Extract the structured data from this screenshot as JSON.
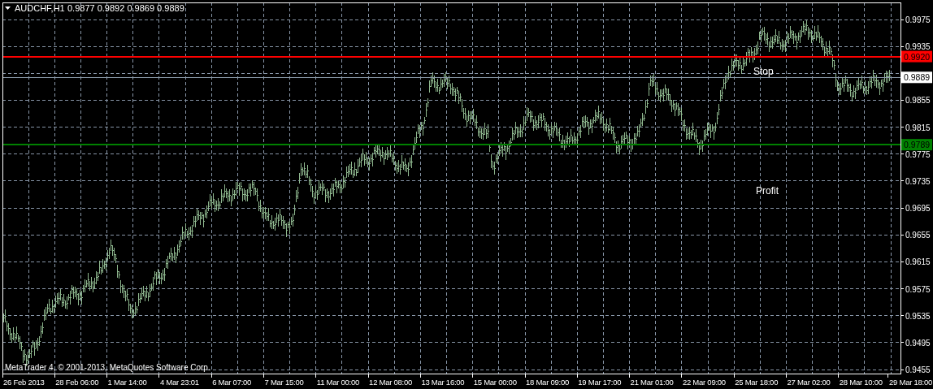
{
  "header": {
    "symbol": "AUDCHF,H1",
    "ohlc": "0.9877 0.9892 0.9869 0.9889"
  },
  "chart": {
    "price_axis": [
      "0.9975",
      "0.9935",
      "0.9855",
      "0.9815",
      "0.9775",
      "0.9735",
      "0.9695",
      "0.9655",
      "0.9615",
      "0.9575",
      "0.9535",
      "0.9495",
      "0.9455"
    ],
    "time_axis": [
      "26 Feb 2013",
      "28 Feb 06:00",
      "1 Mar 14:00",
      "4 Mar 23:01",
      "6 Mar 07:00",
      "7 Mar 15:00",
      "11 Mar 00:00",
      "12 Mar 08:00",
      "13 Mar 16:00",
      "15 Mar 00:00",
      "18 Mar 09:00",
      "19 Mar 17:00",
      "21 Mar 01:00",
      "22 Mar 09:00",
      "25 Mar 18:00",
      "27 Mar 02:00",
      "28 Mar 10:00",
      "29 Mar 18:00"
    ],
    "lines": [
      {
        "kind": "stop",
        "price": "0.9920",
        "color": "#ff0000"
      },
      {
        "kind": "bid",
        "price": "0.9889",
        "color": "#ffffff"
      },
      {
        "kind": "profit",
        "price": "0.9789",
        "color": "#008000"
      }
    ],
    "annotations": [
      {
        "text": "Stop"
      },
      {
        "text": "Profit"
      }
    ],
    "copyright": "MetaTrader 4, © 2001-2013, MetaQuotes Software Corp."
  }
}
